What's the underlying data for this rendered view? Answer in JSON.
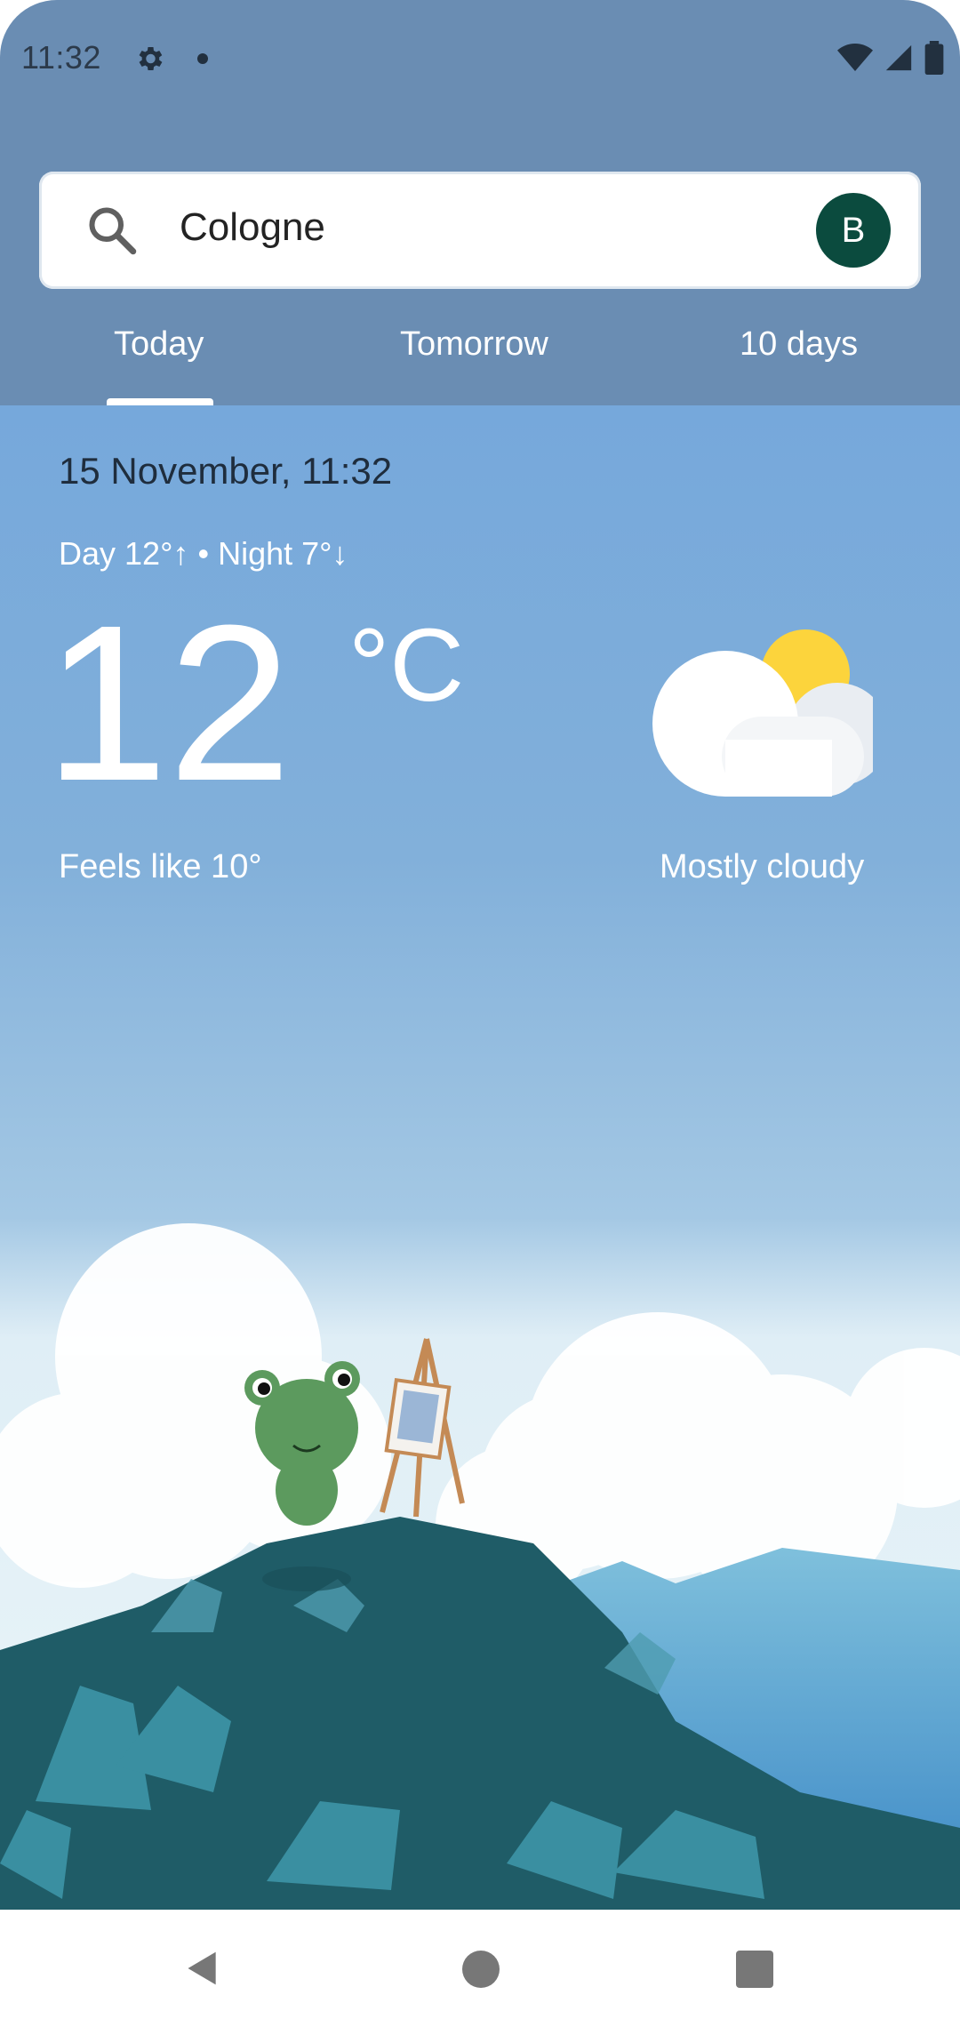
{
  "status_bar": {
    "time": "11:32"
  },
  "search": {
    "query": "Cologne",
    "avatar_initial": "B"
  },
  "tabs": [
    {
      "label": "Today"
    },
    {
      "label": "Tomorrow"
    },
    {
      "label": "10 days"
    }
  ],
  "weather": {
    "date_time": "15 November, 11:32",
    "day_night": "Day 12°↑ • Night 7°↓",
    "temperature": "12",
    "unit": "°C",
    "feels_like": "Feels like 10°",
    "condition": "Mostly cloudy"
  },
  "colors": {
    "header": "#6a8db3",
    "avatar": "#0b4b3e",
    "sky_top": "#76a8db"
  },
  "icons": [
    "settings-gear-icon",
    "wifi-icon",
    "signal-icon",
    "battery-icon",
    "search-icon",
    "mostly-cloudy-icon",
    "nav-back-icon",
    "nav-home-icon",
    "nav-recents-icon"
  ]
}
